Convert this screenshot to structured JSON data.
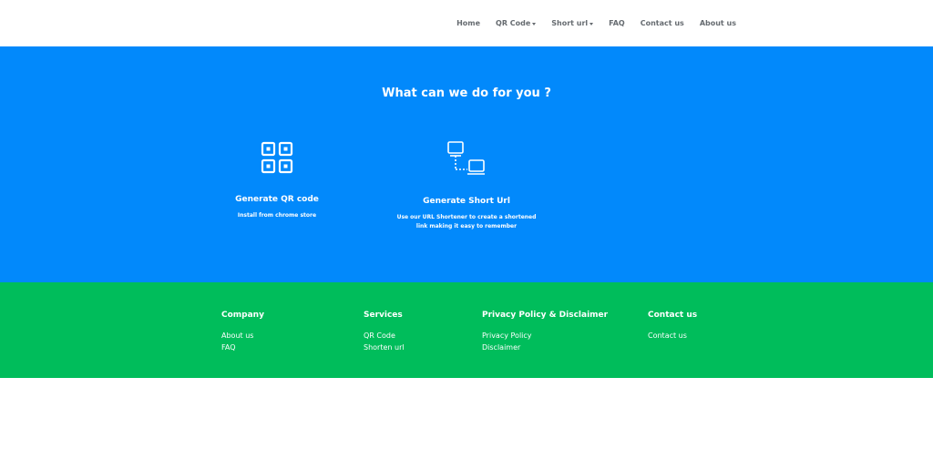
{
  "nav": {
    "items": [
      {
        "label": "Home"
      },
      {
        "label": "QR Code"
      },
      {
        "label": "Short url"
      },
      {
        "label": "FAQ"
      },
      {
        "label": "Contact us"
      },
      {
        "label": "About us"
      }
    ]
  },
  "hero": {
    "title": "What can we do for you ?",
    "services": [
      {
        "title": "Generate QR code",
        "description": "Install from chrome store",
        "icon": "qr-code-icon"
      },
      {
        "title": "Generate Short Url",
        "description_line1": "Use our URL Shortener to create a shortened",
        "description_line2": "link making it easy to remember",
        "icon": "link-flow-icon"
      }
    ]
  },
  "footer": {
    "company": {
      "heading": "Company",
      "links": [
        "About us",
        "FAQ"
      ]
    },
    "services": {
      "heading": "Services",
      "links": [
        "QR Code",
        "Shorten url"
      ]
    },
    "privacy": {
      "heading": "Privacy Policy & Disclaimer",
      "links": [
        "Privacy Policy",
        "Disclaimer"
      ]
    },
    "contact": {
      "heading": "Contact us",
      "links": [
        "Contact us"
      ]
    }
  },
  "colors": {
    "hero_background": "#0289fb",
    "footer_background": "#00bd5b",
    "nav_text": "#666b70"
  }
}
